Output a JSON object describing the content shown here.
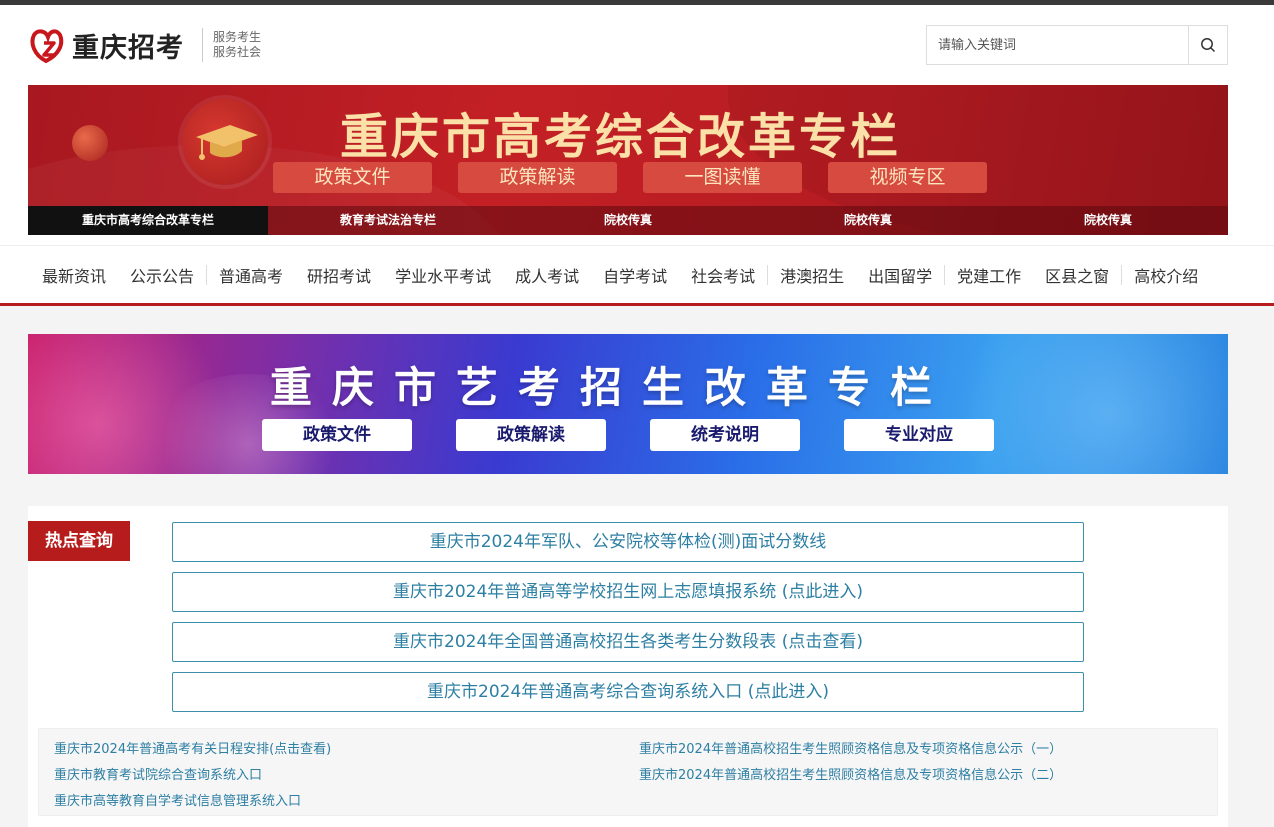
{
  "header": {
    "logo_text": "重庆招考",
    "slogan_line1": "服务考生",
    "slogan_line2": "服务社会",
    "search_placeholder": "请输入关键词"
  },
  "banner_gaokao": {
    "title": "重庆市高考综合改革专栏",
    "buttons": [
      "政策文件",
      "政策解读",
      "一图读懂",
      "视频专区"
    ],
    "tabs": [
      "重庆市高考综合改革专栏",
      "教育考试法治专栏",
      "院校传真",
      "院校传真",
      "院校传真"
    ]
  },
  "nav": {
    "items": [
      "最新资讯",
      "公示公告",
      "普通高考",
      "研招考试",
      "学业水平考试",
      "成人考试",
      "自学考试",
      "社会考试",
      "港澳招生",
      "出国留学",
      "党建工作",
      "区县之窗",
      "高校介绍"
    ]
  },
  "banner_art": {
    "title": "重庆市艺考招生改革专栏",
    "buttons": [
      "政策文件",
      "政策解读",
      "统考说明",
      "专业对应"
    ]
  },
  "hot": {
    "tag": "热点查询",
    "links": [
      "重庆市2024年军队、公安院校等体检(测)面试分数线",
      "重庆市2024年普通高等学校招生网上志愿填报系统 (点此进入)",
      "重庆市2024年全国普通高校招生各类考生分数段表 (点击查看)",
      "重庆市2024年普通高考综合查询系统入口 (点此进入)"
    ],
    "quick_links": [
      "重庆市2024年普通高考有关日程安排(点击查看)",
      "重庆市2024年普通高校招生考生照顾资格信息及专项资格信息公示（一）",
      "重庆市教育考试院综合查询系统入口",
      "重庆市2024年普通高校招生考生照顾资格信息及专项资格信息公示（二）",
      "重庆市高等教育自学考试信息管理系统入口"
    ]
  },
  "colors": {
    "brand_red": "#b71c1c",
    "link_blue": "#2d7fa3"
  }
}
